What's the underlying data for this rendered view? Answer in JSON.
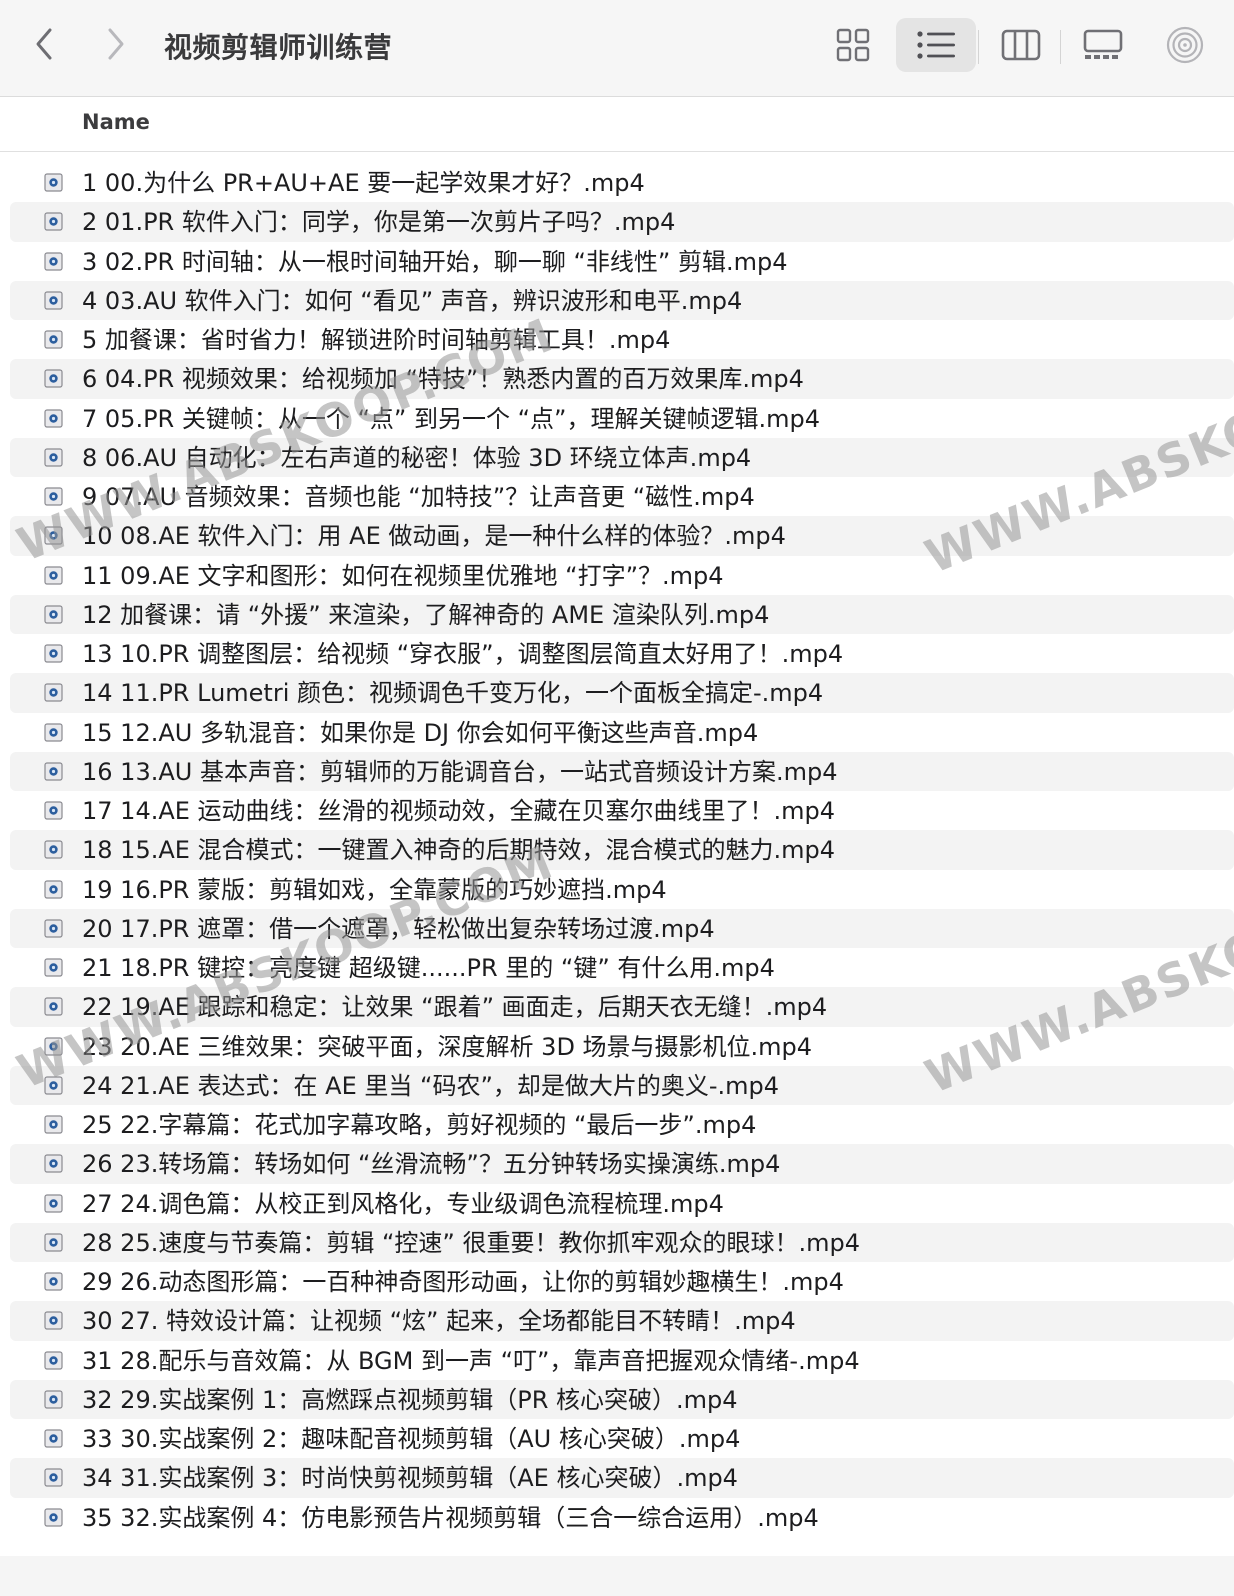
{
  "window": {
    "title": "视频剪辑师训练营"
  },
  "toolbar": {
    "back_icon": "chevron-left-icon",
    "forward_icon": "chevron-right-icon",
    "views": [
      "grid-view-icon",
      "list-view-icon",
      "column-view-icon",
      "gallery-view-icon",
      "airdrop-icon"
    ],
    "active_view": "list"
  },
  "columns": {
    "name": "Name"
  },
  "files": [
    "1 00.为什么 PR+AU+AE 要一起学效果才好？.mp4",
    "2 01.PR 软件入门：同学，你是第一次剪片子吗？.mp4",
    "3 02.PR 时间轴：从一根时间轴开始，聊一聊 “非线性” 剪辑.mp4",
    "4 03.AU 软件入门：如何 “看见” 声音，辨识波形和电平.mp4",
    "5 加餐课：省时省力！解锁进阶时间轴剪辑工具！.mp4",
    "6 04.PR 视频效果：给视频加 “特技”！熟悉内置的百万效果库.mp4",
    "7 05.PR 关键帧：从一个 “点” 到另一个 “点”，理解关键帧逻辑.mp4",
    "8 06.AU 自动化：左右声道的秘密！体验 3D 环绕立体声.mp4",
    "9 07.AU 音频效果：音频也能 “加特技”？让声音更 “磁性.mp4",
    "10 08.AE 软件入门：用 AE 做动画，是一种什么样的体验？.mp4",
    "11 09.AE 文字和图形：如何在视频里优雅地 “打字”？.mp4",
    "12 加餐课：请 “外援” 来渲染，了解神奇的 AME 渲染队列.mp4",
    "13 10.PR 调整图层：给视频 “穿衣服”，调整图层简直太好用了！.mp4",
    "14 11.PR Lumetri 颜色：视频调色千变万化，一个面板全搞定-.mp4",
    "15 12.AU 多轨混音：如果你是 DJ 你会如何平衡这些声音.mp4",
    "16 13.AU 基本声音：剪辑师的万能调音台，一站式音频设计方案.mp4",
    "17 14.AE 运动曲线：丝滑的视频动效，全藏在贝塞尔曲线里了！.mp4",
    "18 15.AE 混合模式：一键置入神奇的后期特效，混合模式的魅力.mp4",
    "19 16.PR 蒙版：剪辑如戏，全靠蒙版的巧妙遮挡.mp4",
    "20 17.PR 遮罩：借一个遮罩，轻松做出复杂转场过渡.mp4",
    "21 18.PR 键控：亮度键 超级键......PR 里的 “键” 有什么用.mp4",
    "22 19.AE 跟踪和稳定：让效果 “跟着” 画面走，后期天衣无缝！.mp4",
    "23 20.AE 三维效果：突破平面，深度解析 3D 场景与摄影机位.mp4",
    "24 21.AE 表达式：在 AE 里当 “码农”，却是做大片的奥义-.mp4",
    "25 22.字幕篇：花式加字幕攻略，剪好视频的 “最后一步”.mp4",
    "26 23.转场篇：转场如何 “丝滑流畅”？五分钟转场实操演练.mp4",
    "27 24.调色篇：从校正到风格化，专业级调色流程梳理.mp4",
    "28 25.速度与节奏篇：剪辑 “控速” 很重要！教你抓牢观众的眼球！.mp4",
    "29 26.动态图形篇：一百种神奇图形动画，让你的剪辑妙趣横生！.mp4",
    "30 27. 特效设计篇：让视频 “炫” 起来，全场都能目不转睛！.mp4",
    "31 28.配乐与音效篇：从 BGM 到一声 “叮”，靠声音把握观众情绪-.mp4",
    "32 29.实战案例 1：高燃踩点视频剪辑（PR 核心突破）.mp4",
    "33 30.实战案例 2：趣味配音视频剪辑（AU 核心突破）.mp4",
    "34 31.实战案例 3：时尚快剪视频剪辑（AE 核心突破）.mp4",
    "35 32.实战案例 4：仿电影预告片视频剪辑（三合一综合运用）.mp4"
  ],
  "watermarks": [
    "WWW.ABSKOOP.COM",
    "WWW.ABSKOOP.COM",
    "WWW.ABSKOOP.COM",
    "WWW.ABSKOOP.COM"
  ],
  "colors": {
    "toolbar_bg": "#f6f6f6",
    "row_alt": "#f3f3f3",
    "active_view_bg": "#e4e4e4",
    "text": "#1d1d1f"
  }
}
